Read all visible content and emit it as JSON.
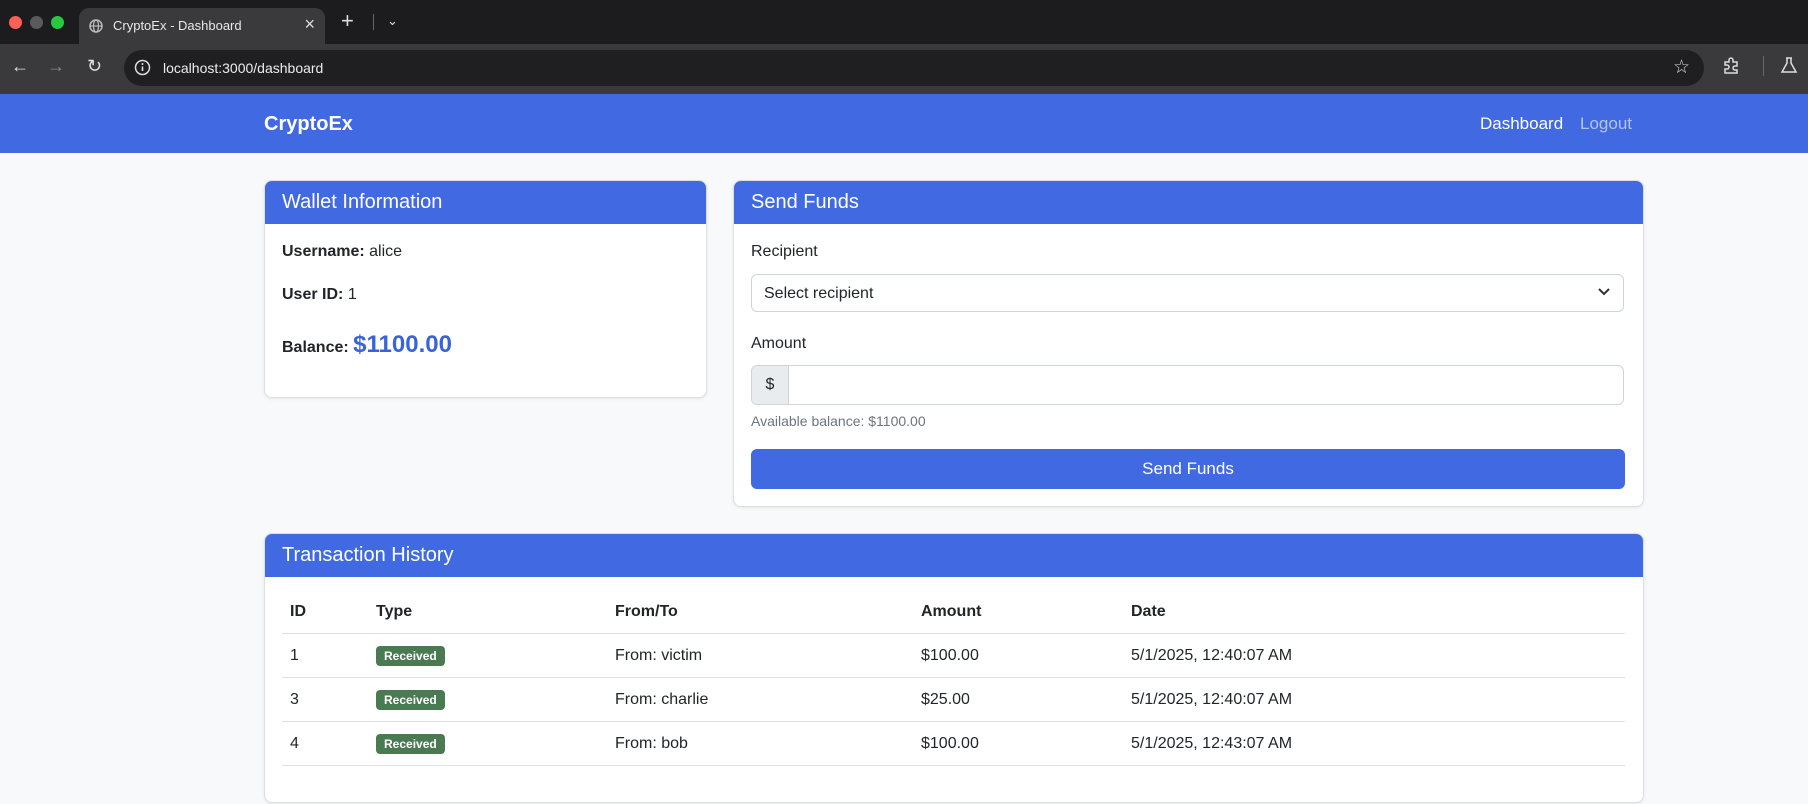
{
  "browser": {
    "tab_title": "CryptoEx - Dashboard",
    "url": "localhost:3000/dashboard"
  },
  "navbar": {
    "brand": "CryptoEx",
    "links": {
      "dashboard": "Dashboard",
      "logout": "Logout"
    }
  },
  "wallet": {
    "title": "Wallet Information",
    "username_label": "Username:",
    "username": "alice",
    "userid_label": "User ID:",
    "userid": "1",
    "balance_label": "Balance:",
    "balance": "$1100.00"
  },
  "send": {
    "title": "Send Funds",
    "recipient_label": "Recipient",
    "recipient_selected": "Select recipient",
    "amount_label": "Amount",
    "currency_prefix": "$",
    "amount_value": "",
    "available_text": "Available balance: $1100.00",
    "button_label": "Send Funds"
  },
  "history": {
    "title": "Transaction History",
    "columns": [
      "ID",
      "Type",
      "From/To",
      "Amount",
      "Date"
    ],
    "rows": [
      {
        "id": "1",
        "type": "Received",
        "party": "From: victim",
        "amount": "$100.00",
        "date": "5/1/2025, 12:40:07 AM"
      },
      {
        "id": "3",
        "type": "Received",
        "party": "From: charlie",
        "amount": "$25.00",
        "date": "5/1/2025, 12:40:07 AM"
      },
      {
        "id": "4",
        "type": "Received",
        "party": "From: bob",
        "amount": "$100.00",
        "date": "5/1/2025, 12:43:07 AM"
      }
    ]
  },
  "colors": {
    "primary": "#4169e1",
    "balance": "#3a63d8",
    "badge_received": "#4a7a52"
  },
  "icons": {
    "tab_favicon": "globe-icon",
    "back": "arrow-left-icon",
    "forward": "arrow-right-icon",
    "reload": "reload-icon",
    "site_info": "info-icon",
    "bookmark": "star-icon",
    "extensions": "puzzle-icon",
    "labs": "flask-icon",
    "select_arrow": "chevron-down-icon"
  }
}
